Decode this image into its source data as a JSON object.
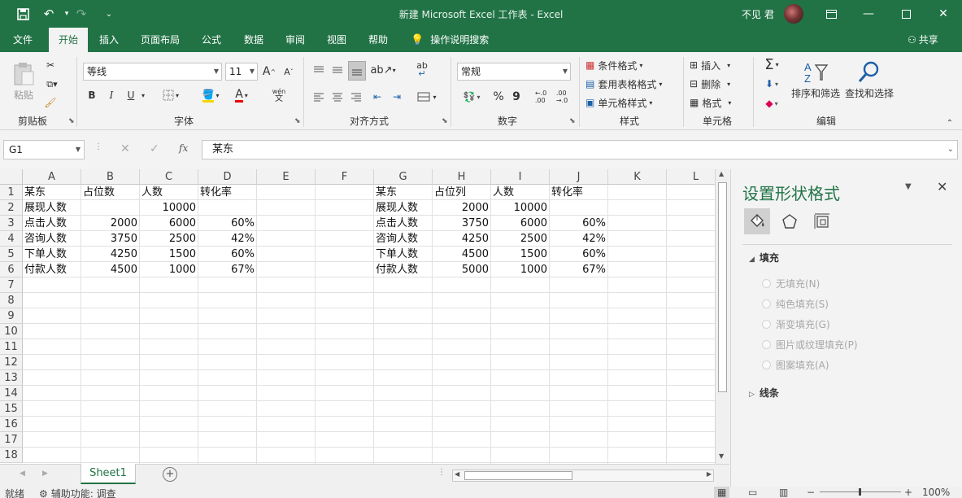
{
  "titlebar": {
    "title": "新建 Microsoft Excel 工作表  -  Excel",
    "user": "不见 君"
  },
  "tabs": [
    "文件",
    "开始",
    "插入",
    "页面布局",
    "公式",
    "数据",
    "审阅",
    "视图",
    "帮助"
  ],
  "active_tab": "开始",
  "tell_me": "操作说明搜索",
  "share": "共享",
  "ribbon": {
    "clipboard": {
      "paste": "粘贴",
      "label": "剪贴板"
    },
    "font": {
      "name": "等线",
      "size": "11",
      "bold": "B",
      "italic": "I",
      "underline": "U",
      "label": "字体",
      "grow": "A",
      "shrink": "A",
      "phonetic": "wén",
      "phonetic_char": "文"
    },
    "align": {
      "label": "对齐方式",
      "wrap": "ab"
    },
    "number": {
      "format": "常规",
      "percent": "%",
      "comma": "9",
      "label": "数字",
      "inc": "←.0\n.00",
      "dec": ".00\n→.0"
    },
    "styles": {
      "cond": "条件格式",
      "table": "套用表格格式",
      "cell": "单元格样式",
      "label": "样式"
    },
    "cells": {
      "insert": "插入",
      "delete": "删除",
      "format": "格式",
      "label": "单元格"
    },
    "edit": {
      "sum": "Σ",
      "sort": "排序和筛选",
      "find": "查找和选择",
      "label": "编辑"
    }
  },
  "formula": {
    "namebox": "G1",
    "fx": "fx",
    "value": "某东"
  },
  "columns": [
    "A",
    "B",
    "C",
    "D",
    "E",
    "F",
    "G",
    "H",
    "I",
    "J",
    "K",
    "L"
  ],
  "rows": [
    "1",
    "2",
    "3",
    "4",
    "5",
    "6",
    "7",
    "8",
    "9",
    "10",
    "11",
    "12",
    "13",
    "14",
    "15",
    "16",
    "17",
    "18"
  ],
  "cells": {
    "left": [
      [
        "某东",
        "占位数",
        "人数",
        "转化率"
      ],
      [
        "展现人数",
        "",
        "10000",
        ""
      ],
      [
        "点击人数",
        "2000",
        "6000",
        "60%"
      ],
      [
        "咨询人数",
        "3750",
        "2500",
        "42%"
      ],
      [
        "下单人数",
        "4250",
        "1500",
        "60%"
      ],
      [
        "付款人数",
        "4500",
        "1000",
        "67%"
      ]
    ],
    "right": [
      [
        "某东",
        "占位列",
        "人数",
        "转化率"
      ],
      [
        "展现人数",
        "2000",
        "10000",
        ""
      ],
      [
        "点击人数",
        "3750",
        "6000",
        "60%"
      ],
      [
        "咨询人数",
        "4250",
        "2500",
        "42%"
      ],
      [
        "下单人数",
        "4500",
        "1500",
        "60%"
      ],
      [
        "付款人数",
        "5000",
        "1000",
        "67%"
      ]
    ]
  },
  "sheet_tab": "Sheet1",
  "status": {
    "ready": "就绪",
    "accessibility": "辅助功能: 调查",
    "zoom": "100%"
  },
  "pane": {
    "title": "设置形状格式",
    "fill_section": "填充",
    "line_section": "线条",
    "options": [
      "无填充(N)",
      "纯色填充(S)",
      "渐变填充(G)",
      "图片或纹理填充(P)",
      "图案填充(A)"
    ]
  }
}
